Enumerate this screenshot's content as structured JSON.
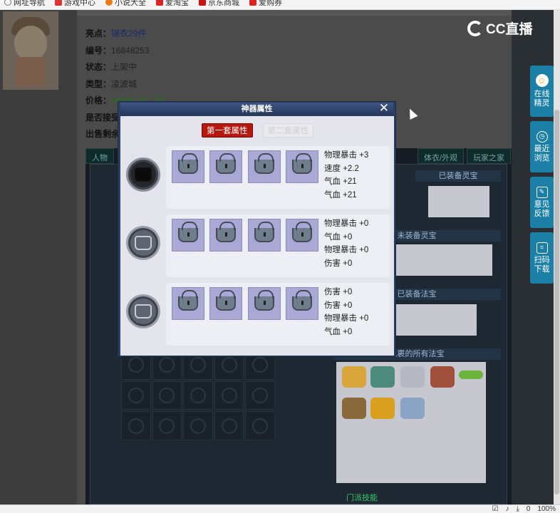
{
  "bookmarks": [
    {
      "label": "网址导航",
      "color": "#777"
    },
    {
      "label": "游戏中心",
      "color": "#d33"
    },
    {
      "label": "小说大全",
      "color": "#e97a1a"
    },
    {
      "label": "爱淘宝",
      "color": "#d22"
    },
    {
      "label": "京东商城",
      "color": "#c11"
    },
    {
      "label": "爱购券",
      "color": "#d22"
    }
  ],
  "brand": {
    "logo_text": "CC直播"
  },
  "item_info": {
    "highlight_key": "亮点：",
    "highlight_val": "锦衣29件",
    "id_key": "编号：",
    "id_val": "16848253",
    "status_key": "状态：",
    "status_val": "上架中",
    "type_key": "类型：",
    "type_val": "凌波城",
    "price_key": "价格：",
    "price_val": "¥8888.00（元）",
    "accept_key": "是否接受",
    "remain_key": "出售剩余"
  },
  "game_tabs": [
    "人物",
    "体衣/外观",
    "玩家之家"
  ],
  "right_headers": {
    "equipped_lingbao": "已装备灵宝",
    "unequipped_lingbao": "未装备灵宝",
    "equipped_fabao": "已装备法宝",
    "all_fabao": "包裹的所有法宝"
  },
  "bottom_text": "门派技能",
  "side_buttons": [
    {
      "icon": "online-spirit-icon",
      "line1": "在线",
      "line2": "精灵"
    },
    {
      "icon": "clock-icon",
      "line1": "最近",
      "line2": "浏览"
    },
    {
      "icon": "edit-icon",
      "line1": "意见",
      "line2": "反馈"
    },
    {
      "icon": "scan-icon",
      "line1": "扫码",
      "line2": "下载"
    }
  ],
  "status_bar": {
    "zoom": "100%",
    "count": "0"
  },
  "modal": {
    "title": "神器属性",
    "tab_active": "第一套属性",
    "tab_inactive": "第二套属性",
    "sets": [
      {
        "orb": "black",
        "attrs": [
          "物理暴击 +3",
          "速度 +2.2",
          "气血 +21",
          "气血 +21"
        ]
      },
      {
        "orb": "grey",
        "attrs": [
          "物理暴击 +0",
          "气血 +0",
          "物理暴击 +0",
          "伤害 +0"
        ]
      },
      {
        "orb": "grey",
        "attrs": [
          "伤害 +0",
          "伤害 +0",
          "物理暴击 +0",
          "气血 +0"
        ]
      }
    ]
  }
}
